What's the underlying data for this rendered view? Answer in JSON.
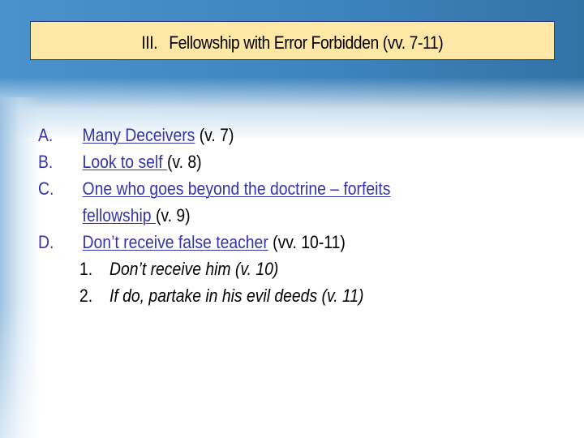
{
  "slide": {
    "title_number": "III.",
    "title": "Fellowship with Error Forbidden (vv. 7-11)",
    "colors": {
      "title_bg": "#ffe8a6",
      "title_border": "#2d3b8c",
      "link": "#3333aa",
      "header_blue": "#3f86c0"
    },
    "items": [
      {
        "marker": "A.",
        "link": "Many Deceivers",
        "ref": " (v. 7)"
      },
      {
        "marker": "B.",
        "link": "Look to self ",
        "ref": "(v. 8)"
      },
      {
        "marker": "C.",
        "link": "One who goes beyond the doctrine – forfeits",
        "ref": ""
      },
      {
        "marker": "",
        "link": "fellowship ",
        "ref": "(v. 9)"
      },
      {
        "marker": "D.",
        "link": "Don’t receive false teacher",
        "ref": " (vv. 10-11)"
      }
    ],
    "subitems": [
      {
        "number": "1.",
        "text": "Don’t receive him (v. 10)"
      },
      {
        "number": "2.",
        "text": "If do, partake in his evil deeds (v. 11)"
      }
    ]
  }
}
